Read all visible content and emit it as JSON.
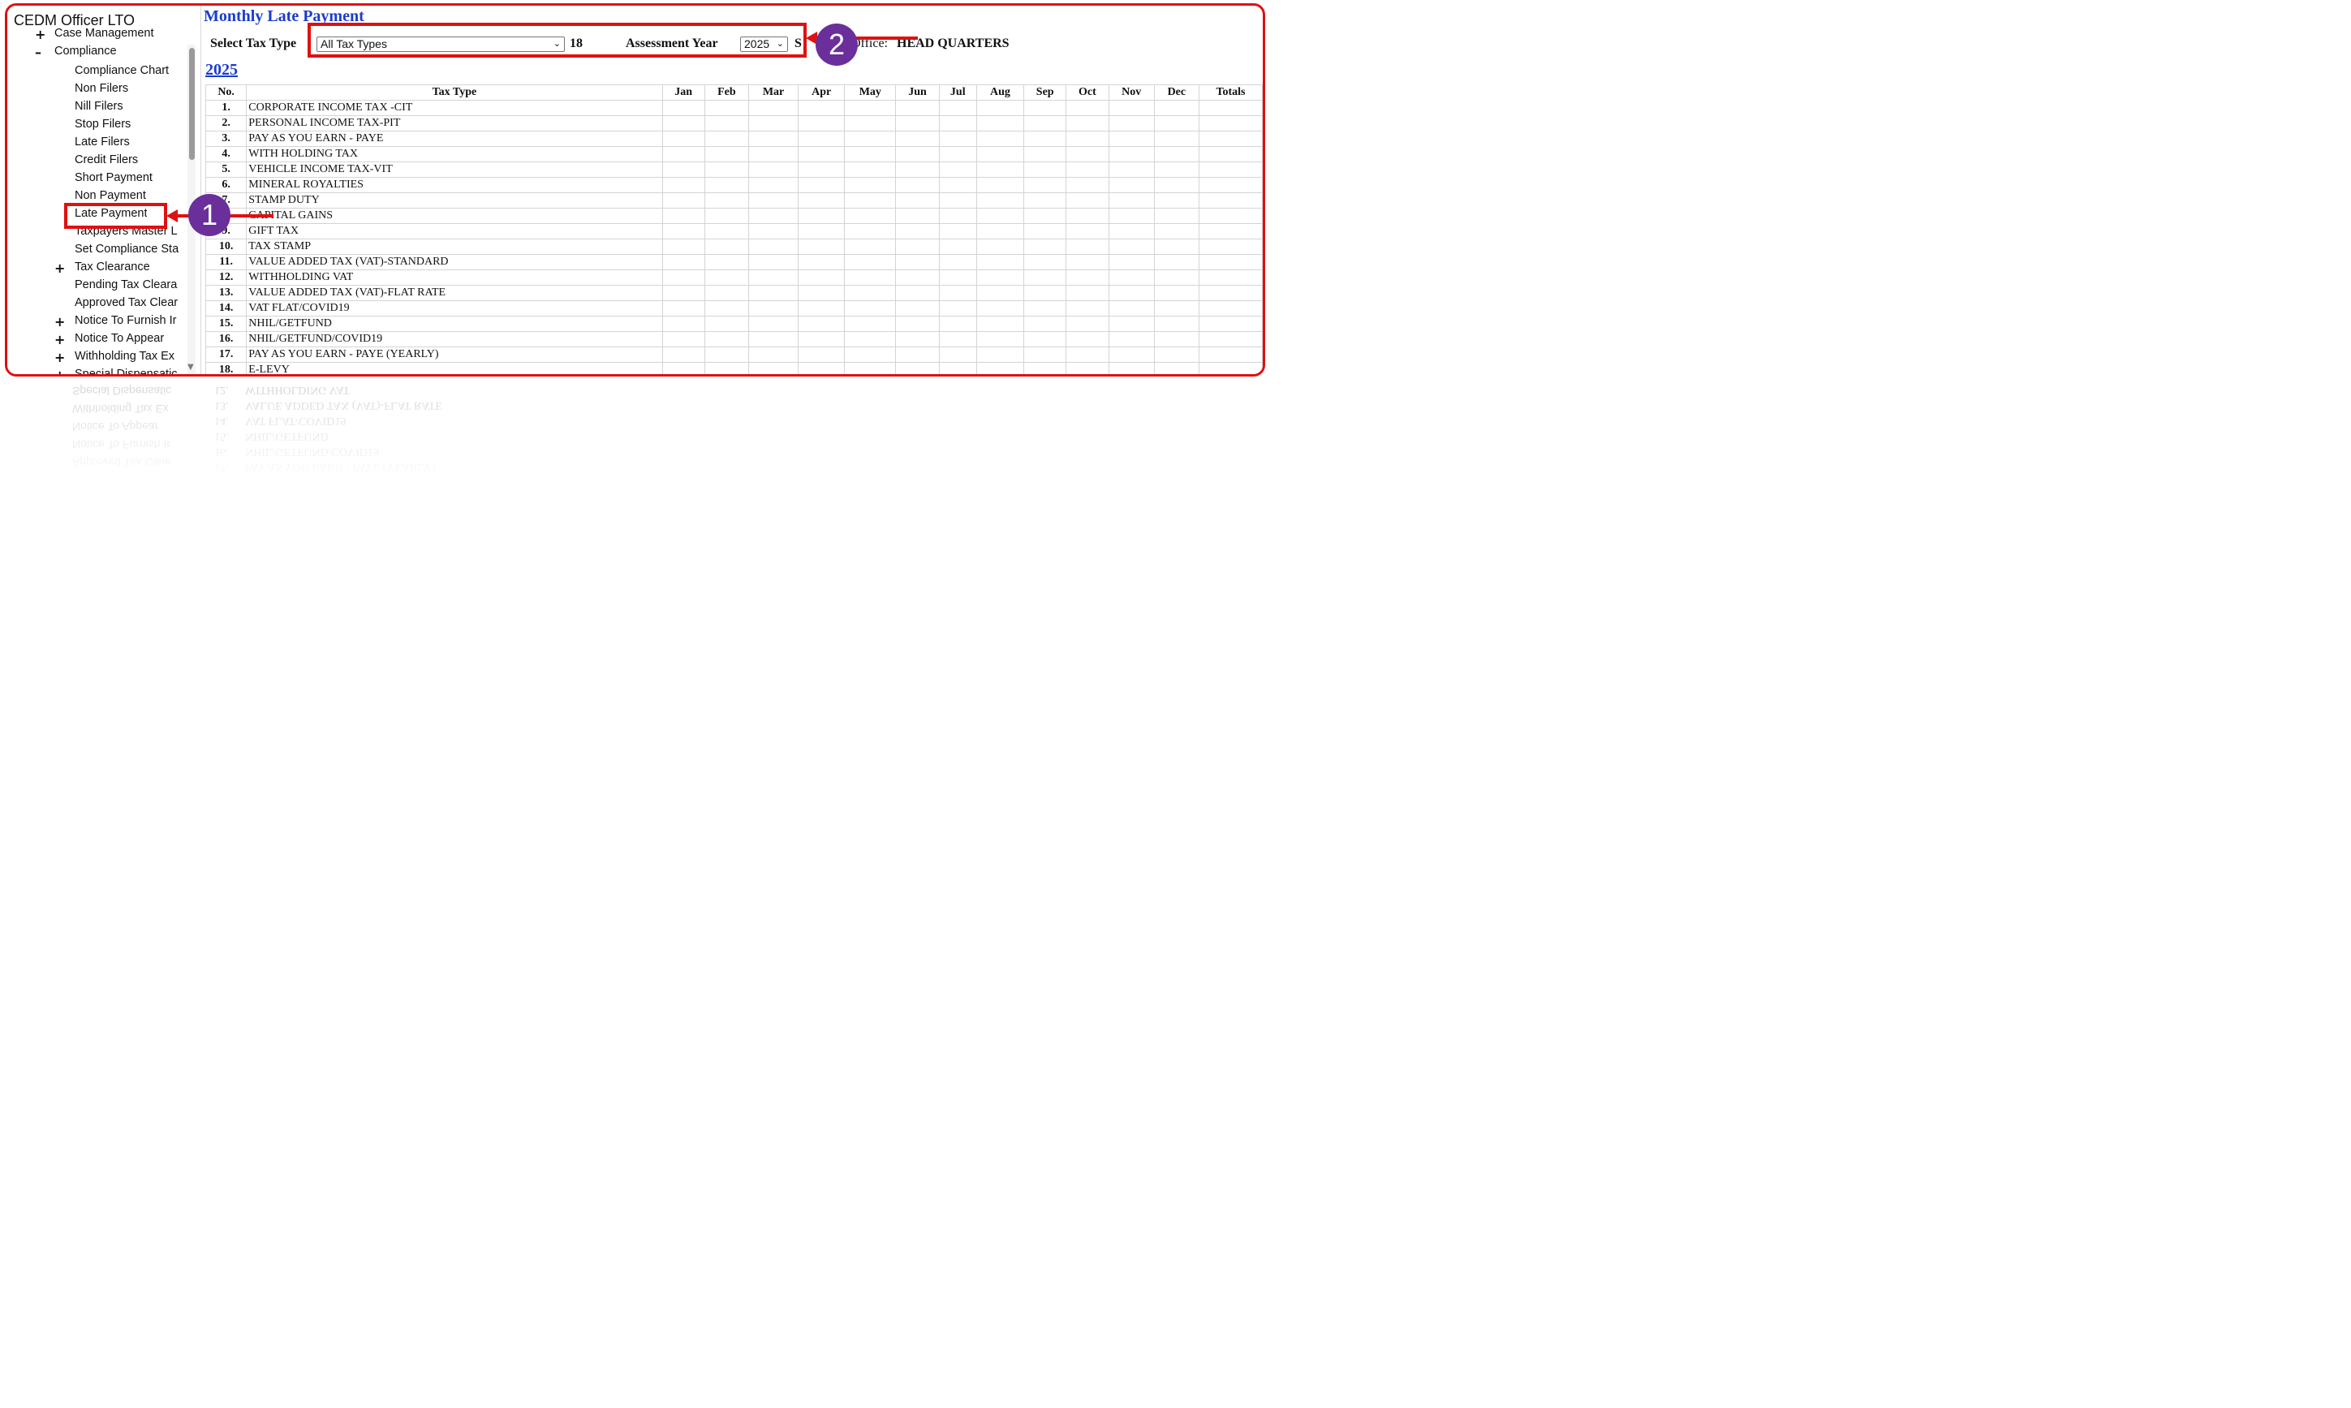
{
  "app": {
    "title": "CEDM Officer LTO"
  },
  "sidebar": {
    "items": [
      {
        "label": "Case Management",
        "toggle": "+"
      },
      {
        "label": "Compliance",
        "toggle": "–"
      },
      {
        "label": "Compliance Chart"
      },
      {
        "label": "Non Filers"
      },
      {
        "label": "Nill Filers"
      },
      {
        "label": "Stop Filers"
      },
      {
        "label": "Late Filers"
      },
      {
        "label": "Credit Filers"
      },
      {
        "label": "Short Payment"
      },
      {
        "label": "Non Payment"
      },
      {
        "label": "Late Payment"
      },
      {
        "label": "Taxpayers Master L"
      },
      {
        "label": "Set Compliance Sta"
      },
      {
        "label": "Tax Clearance",
        "toggle": "+"
      },
      {
        "label": "Pending Tax Cleara"
      },
      {
        "label": "Approved Tax Clear"
      },
      {
        "label": "Notice To Furnish Ir",
        "toggle": "+"
      },
      {
        "label": "Notice To Appear",
        "toggle": "+"
      },
      {
        "label": "Withholding Tax Ex",
        "toggle": "+"
      },
      {
        "label": "Special Dispensatic",
        "toggle": "+"
      }
    ]
  },
  "main": {
    "title": "Monthly Late Payment",
    "filters": {
      "tax_type_label": "Select Tax Type",
      "tax_type_value": "All Tax Types",
      "count": "18",
      "year_label": "Assessment Year",
      "year_value": "2025",
      "trailing": "S",
      "office_label": "Office:",
      "office_value": "HEAD QUARTERS"
    },
    "year_link": "2025",
    "table": {
      "headers": [
        "No.",
        "Tax Type",
        "Jan",
        "Feb",
        "Mar",
        "Apr",
        "May",
        "Jun",
        "Jul",
        "Aug",
        "Sep",
        "Oct",
        "Nov",
        "Dec",
        "Totals"
      ],
      "rows": [
        {
          "no": "1.",
          "type": "CORPORATE INCOME TAX -CIT"
        },
        {
          "no": "2.",
          "type": "PERSONAL INCOME TAX-PIT"
        },
        {
          "no": "3.",
          "type": "PAY AS YOU EARN - PAYE"
        },
        {
          "no": "4.",
          "type": "WITH HOLDING TAX"
        },
        {
          "no": "5.",
          "type": "VEHICLE INCOME TAX-VIT"
        },
        {
          "no": "6.",
          "type": "MINERAL ROYALTIES"
        },
        {
          "no": "7.",
          "type": "STAMP DUTY"
        },
        {
          "no": "8.",
          "type": "CAPITAL GAINS"
        },
        {
          "no": "9.",
          "type": "GIFT TAX"
        },
        {
          "no": "10.",
          "type": "TAX STAMP"
        },
        {
          "no": "11.",
          "type": "VALUE ADDED TAX (VAT)-STANDARD"
        },
        {
          "no": "12.",
          "type": "WITHHOLDING VAT"
        },
        {
          "no": "13.",
          "type": "VALUE ADDED TAX (VAT)-FLAT RATE"
        },
        {
          "no": "14.",
          "type": "VAT FLAT/COVID19"
        },
        {
          "no": "15.",
          "type": "NHIL/GETFUND"
        },
        {
          "no": "16.",
          "type": "NHIL/GETFUND/COVID19"
        },
        {
          "no": "17.",
          "type": "PAY AS YOU EARN - PAYE (YEARLY)"
        },
        {
          "no": "18.",
          "type": "E-LEVY"
        }
      ]
    }
  },
  "callouts": [
    {
      "number": "1",
      "target": "Late Payment"
    },
    {
      "number": "2",
      "target": "Select Tax Type / Assessment Year"
    }
  ],
  "colors": {
    "accent_red": "#e01010",
    "title_blue": "#1a3ccf",
    "badge_purple": "#6a2f9b"
  }
}
